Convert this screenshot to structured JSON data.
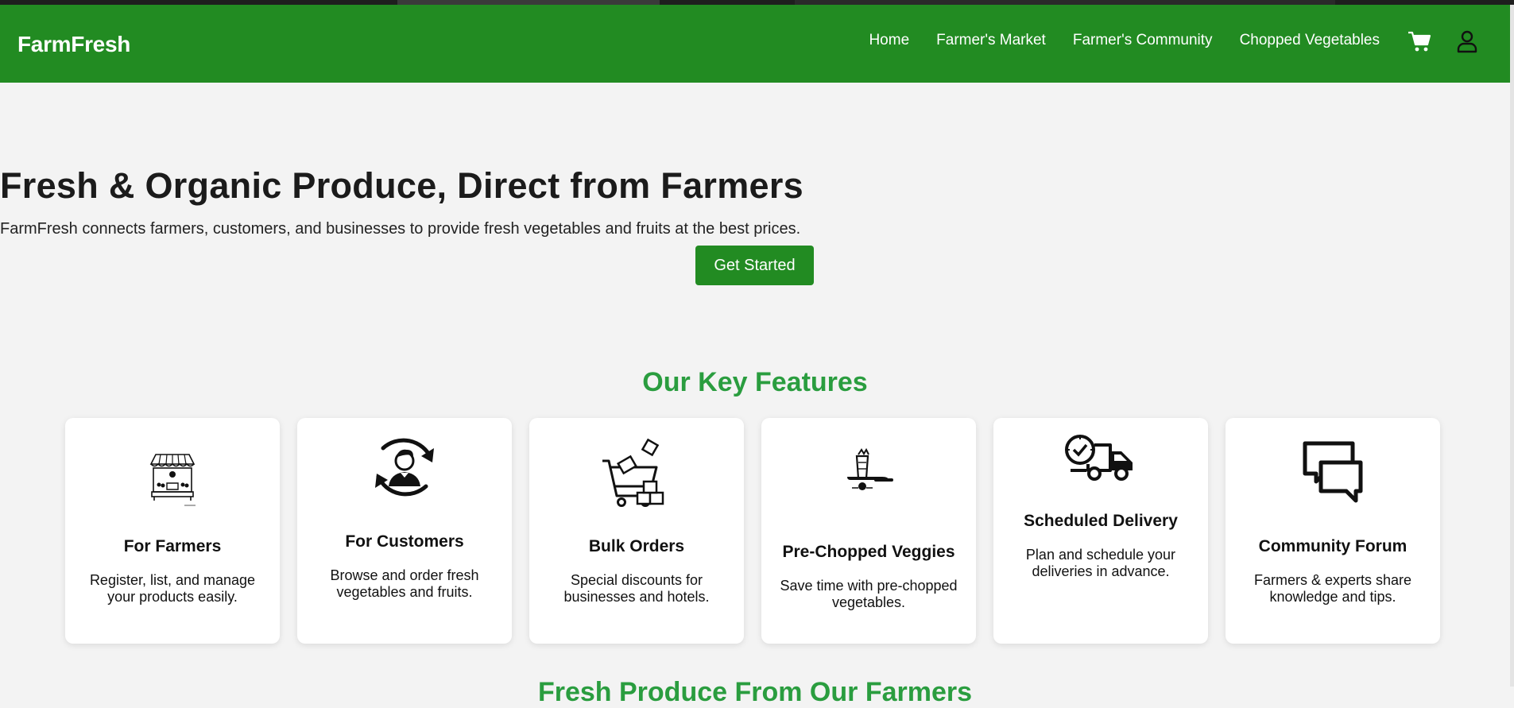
{
  "brand": "FarmFresh",
  "colors": {
    "primary": "#228b22",
    "accent_heading": "#2a9d3f",
    "background": "#f3f3f3",
    "card": "#ffffff"
  },
  "nav": {
    "links": [
      "Home",
      "Farmer's Market",
      "Farmer's Community",
      "Chopped Vegetables"
    ],
    "icons": [
      "cart-icon",
      "user-icon"
    ]
  },
  "hero": {
    "title": "Fresh & Organic Produce, Direct from Farmers",
    "subtitle": "FarmFresh connects farmers, customers, and businesses to provide fresh vegetables and fruits at the best prices.",
    "cta_label": "Get Started"
  },
  "features": {
    "heading": "Our Key Features",
    "cards": [
      {
        "title": "For Farmers",
        "desc": "Register, list, and manage your products easily.",
        "icon": "market-stall-icon"
      },
      {
        "title": "For Customers",
        "desc": "Browse and order fresh vegetables and fruits.",
        "icon": "customer-cycle-icon"
      },
      {
        "title": "Bulk Orders",
        "desc": "Special discounts for businesses and hotels.",
        "icon": "bulk-cart-icon"
      },
      {
        "title": "Pre-Chopped Veggies",
        "desc": "Save time with pre-chopped vegetables.",
        "icon": "knife-carrot-icon"
      },
      {
        "title": "Scheduled Delivery",
        "desc": "Plan and schedule your deliveries in advance.",
        "icon": "delivery-truck-icon"
      },
      {
        "title": "Community Forum",
        "desc": "Farmers & experts share knowledge and tips.",
        "icon": "chat-bubbles-icon"
      }
    ]
  },
  "next_section": {
    "heading": "Fresh Produce From Our Farmers"
  }
}
